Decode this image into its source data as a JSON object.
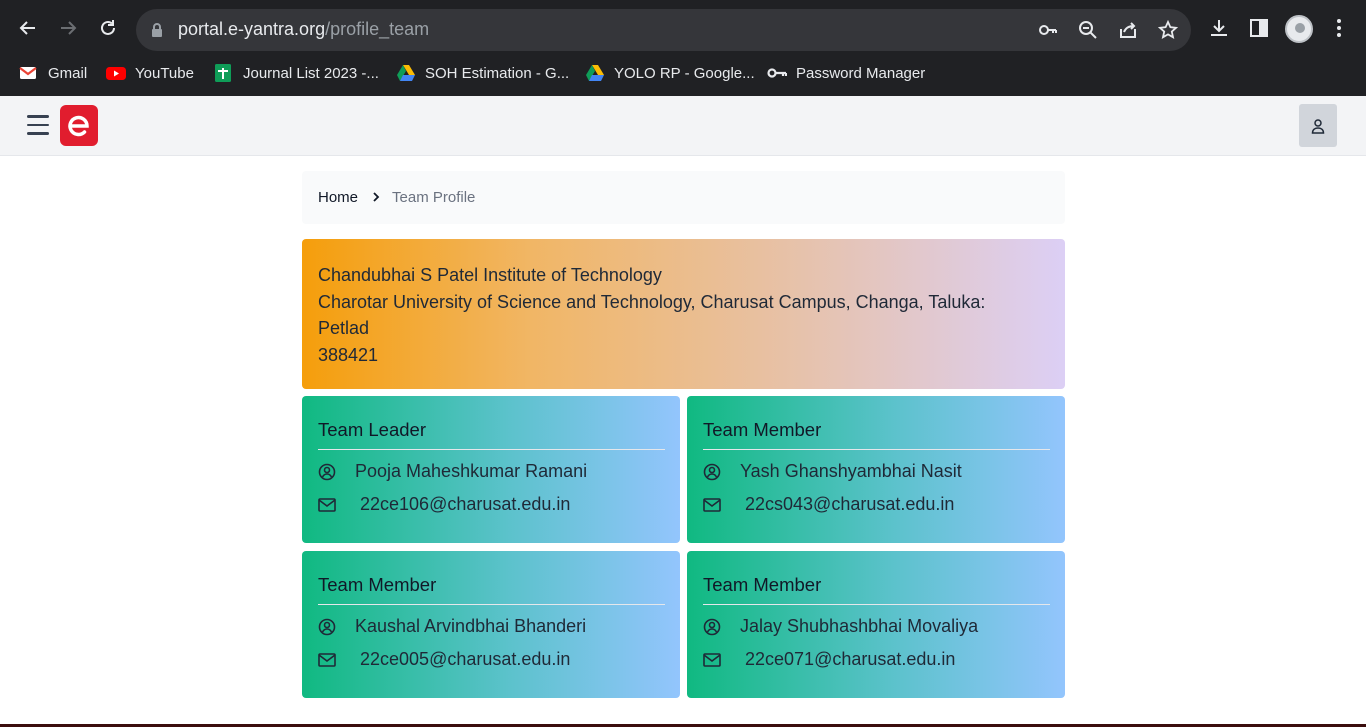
{
  "browser": {
    "url_domain": "portal.e-yantra.org",
    "url_path": "/profile_team",
    "bookmarks": [
      {
        "label": "Gmail",
        "icon": "gmail-icon"
      },
      {
        "label": "YouTube",
        "icon": "youtube-icon"
      },
      {
        "label": "Journal List 2023 -...",
        "icon": "sheets-icon"
      },
      {
        "label": "SOH Estimation - G...",
        "icon": "drive-icon"
      },
      {
        "label": "YOLO RP - Google...",
        "icon": "drive-icon"
      },
      {
        "label": "Password Manager",
        "icon": "key-icon"
      }
    ]
  },
  "breadcrumb": {
    "home": "Home",
    "current": "Team Profile"
  },
  "institute": {
    "line1": "Chandubhai S Patel Institute of Technology",
    "line2": "Charotar University of Science and Technology, Charusat Campus, Changa, Taluka:",
    "line3": "Petlad",
    "line4": "388421"
  },
  "members": [
    {
      "role": "Team Leader",
      "name": "Pooja Maheshkumar Ramani",
      "email": "22ce106@charusat.edu.in"
    },
    {
      "role": "Team Member",
      "name": "Yash Ghanshyambhai Nasit",
      "email": "22cs043@charusat.edu.in"
    },
    {
      "role": "Team Member",
      "name": "Kaushal Arvindbhai Bhanderi",
      "email": "22ce005@charusat.edu.in"
    },
    {
      "role": "Team Member",
      "name": "Jalay Shubhashbhai Movaliya",
      "email": "22ce071@charusat.edu.in"
    }
  ],
  "colors": {
    "brand_red": "#e11d2e",
    "institute_gradient_start": "#f59e0b",
    "institute_gradient_end": "#dccff5",
    "member_gradient_start": "#10b981",
    "member_gradient_end": "#93c5fd"
  }
}
